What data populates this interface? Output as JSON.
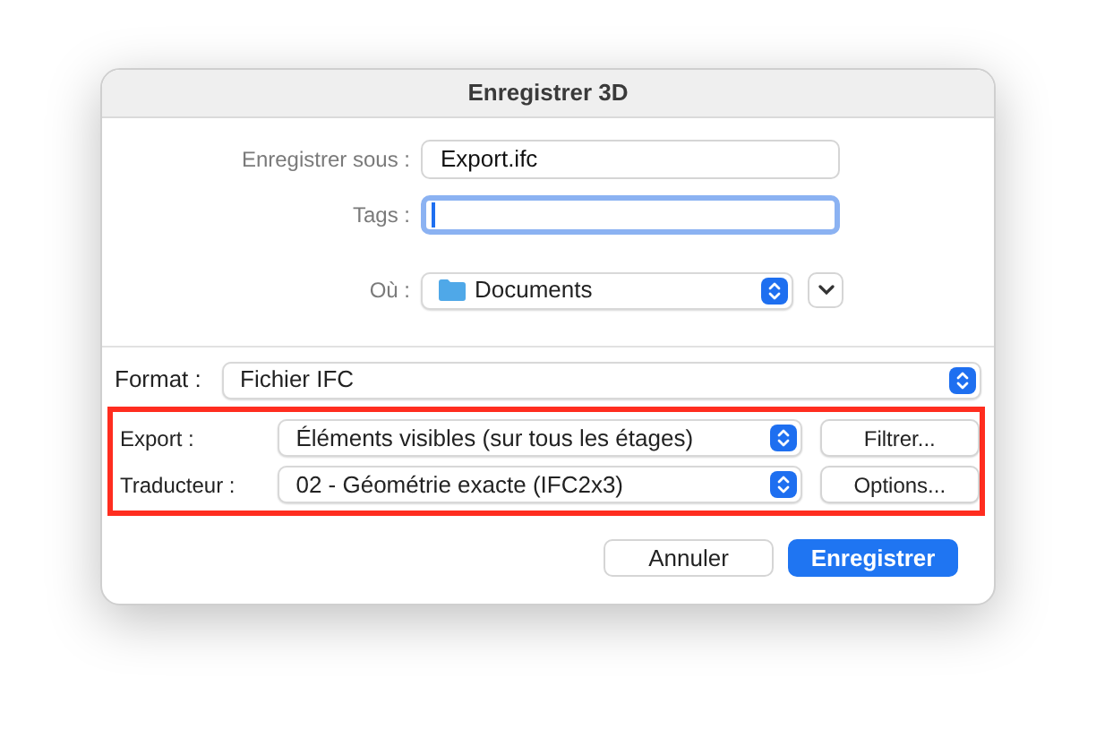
{
  "window": {
    "title": "Enregistrer 3D"
  },
  "save_as": {
    "label": "Enregistrer sous :",
    "value": "Export.ifc"
  },
  "tags": {
    "label": "Tags :",
    "focused": true
  },
  "location": {
    "label": "Où :",
    "value": "Documents",
    "expanded": false
  },
  "format": {
    "label": "Format :",
    "value": "Fichier IFC"
  },
  "highlight": {
    "visible": true,
    "color": "#ff2d1f"
  },
  "options": [
    {
      "label": "Export :",
      "value": "Éléments visibles (sur tous les étages)",
      "button": "Filtrer..."
    },
    {
      "label": "Traducteur :",
      "value": "02 - Géométrie exacte (IFC2x3)",
      "button": "Options..."
    }
  ],
  "buttons": [
    {
      "label": "Annuler",
      "kind": "default"
    },
    {
      "label": "Enregistrer",
      "kind": "primary"
    }
  ]
}
